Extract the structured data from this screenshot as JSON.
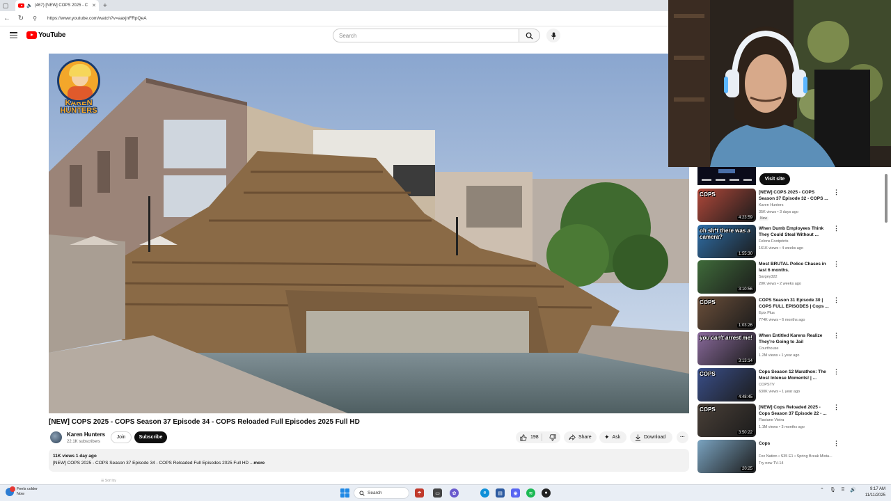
{
  "browser": {
    "tab_title": "(467) [NEW] COPS 2025 - C",
    "url": "https://www.youtube.com/watch?v=aaxjnFRpQeA"
  },
  "youtube": {
    "logo_text": "YouTube",
    "search_placeholder": "Search"
  },
  "player": {
    "logo_text_line1": "KAREN",
    "logo_text_line2": "HUNTERS"
  },
  "video": {
    "title": "[NEW] COPS 2025 - COPS Season 37 Episode 34 - COPS Reloaded Full Episodes 2025 Full HD",
    "channel": "Karen Hunters",
    "subscribers": "22.1K subscribers",
    "join_label": "Join",
    "subscribe_label": "Subscribe",
    "likes": "198",
    "share_label": "Share",
    "ask_label": "Ask",
    "download_label": "Download",
    "views_date": "11K views  1 day ago",
    "description": "[NEW] COPS 2025 - COPS Season 37 Episode 34 - COPS Reloaded Full Episodes 2025 Full HD ...",
    "more_label": "more",
    "below_text": "Sort by"
  },
  "sidebar": {
    "ad_visit_label": "Visit site",
    "recommendations": [
      {
        "title": "[NEW] COPS 2025 - COPS Season 37 Episode 32 - COPS ...",
        "channel": "Karen Hunters",
        "meta": "35K views • 3 days ago",
        "badge": "New",
        "duration": "4:23:59",
        "overlay": "COPS",
        "thumb_color": "#b0483a"
      },
      {
        "title": "When Dumb Employees Think They Could Steal Without ...",
        "channel": "Felons Footprints",
        "meta": "161K views • 4 weeks ago",
        "badge": "",
        "duration": "1:55:30",
        "overlay": "oh sh*t there was a camera?",
        "thumb_color": "#2f6fa8"
      },
      {
        "title": "Most BRUTAL Police Chases in last 6 months.",
        "channel": "Sargey322",
        "meta": "20K views • 2 weeks ago",
        "badge": "",
        "duration": "3:10:56",
        "overlay": "",
        "thumb_color": "#3f6b3a"
      },
      {
        "title": "COPS Season 31 Episode 30 | COPS FULL EPISODES | Cops ...",
        "channel": "Epix Plus",
        "meta": "774K views • 6 months ago",
        "badge": "",
        "duration": "1:03:26",
        "overlay": "COPS",
        "thumb_color": "#6b4f3a"
      },
      {
        "title": "When Entitled Karens Realize They're Going to Jail",
        "channel": "Courthouse",
        "meta": "1.2M views • 1 year ago",
        "badge": "",
        "duration": "3:13:14",
        "overlay": "you can't arrest me!",
        "thumb_color": "#8a6a9c"
      },
      {
        "title": "Cops Season 12 Marathon: The Most Intense Moments! | ...",
        "channel": "COPSTV",
        "meta": "630K views • 1 year ago",
        "badge": "",
        "duration": "4:48:45",
        "overlay": "COPS",
        "thumb_color": "#3a4f8a"
      },
      {
        "title": "[NEW] Cops Reloaded 2025 - Cops Season 37 Episode 22 - ...",
        "channel": "Flaviane Vieira",
        "meta": "1.1M views • 3 months ago",
        "badge": "",
        "duration": "3:50:22",
        "overlay": "COPS",
        "thumb_color": "#4a4038"
      },
      {
        "title": "Cops",
        "channel": "Fox Nation • S35 E1 • Spring Break Mista...",
        "meta": "Try now  TV-14",
        "badge": "",
        "duration": "20:25",
        "overlay": "",
        "thumb_color": "#7aa3c0"
      }
    ]
  },
  "taskbar": {
    "weather_line1": "Feels colder",
    "weather_line2": "Now",
    "search_label": "Search",
    "time": "9:17 AM",
    "date": "11/11/2025"
  }
}
